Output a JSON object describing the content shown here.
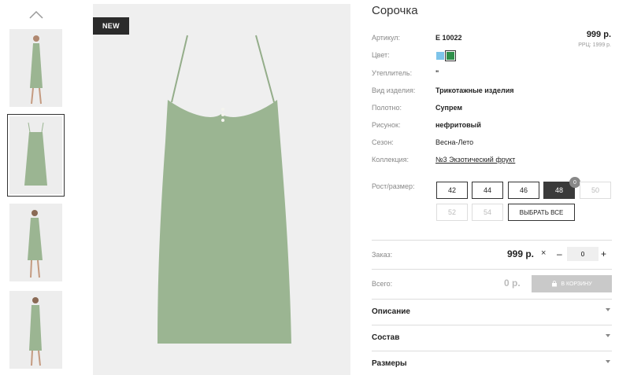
{
  "badge": "NEW",
  "product": {
    "title": "Сорочка",
    "price": "999 р.",
    "rrc": "РРЦ: 1999 р."
  },
  "attrs": [
    {
      "key": "Артикул:",
      "value": "E 10022",
      "style": "bold"
    },
    {
      "key": "Цвет:",
      "value": "",
      "style": "bold"
    },
    {
      "key": "Утеплитель:",
      "value": "\"",
      "style": "bold"
    },
    {
      "key": "Вид изделия:",
      "value": "Трикотажные изделия",
      "style": "bold"
    },
    {
      "key": "Полотно:",
      "value": "Супрем",
      "style": "bold"
    },
    {
      "key": "Рисунок:",
      "value": "нефритовый",
      "style": "bold"
    },
    {
      "key": "Сезон:",
      "value": "Весна-Лето",
      "style": "plain"
    },
    {
      "key": "Коллекция:",
      "value": "№3 Экзотический фрукт",
      "style": "link"
    }
  ],
  "colors": {
    "swatch1": "#7ec4ea",
    "swatch2": "#2f8f4a",
    "dress": "#9bb592",
    "dark": "#3a3a3a"
  },
  "sizes": {
    "label": "Рост/размер:",
    "items": [
      {
        "label": "42",
        "state": "normal"
      },
      {
        "label": "44",
        "state": "normal"
      },
      {
        "label": "46",
        "state": "normal"
      },
      {
        "label": "48",
        "state": "selected"
      },
      {
        "label": "50",
        "state": "disabled"
      },
      {
        "label": "52",
        "state": "disabled"
      },
      {
        "label": "54",
        "state": "disabled"
      }
    ],
    "count": "0",
    "select_all": "ВЫБРАТЬ ВСЕ"
  },
  "order": {
    "label": "Заказ:",
    "price": "999 р.",
    "mult": "×",
    "minus": "–",
    "qty": "0",
    "plus": "+"
  },
  "total": {
    "label": "Всего:",
    "value": "0 р.",
    "cart": "В КОРЗИНУ"
  },
  "accordion": [
    "Описание",
    "Состав",
    "Размеры"
  ],
  "icons": [
    "chevron-up-icon",
    "cart-icon",
    "caret-down-icon",
    "close-icon"
  ]
}
